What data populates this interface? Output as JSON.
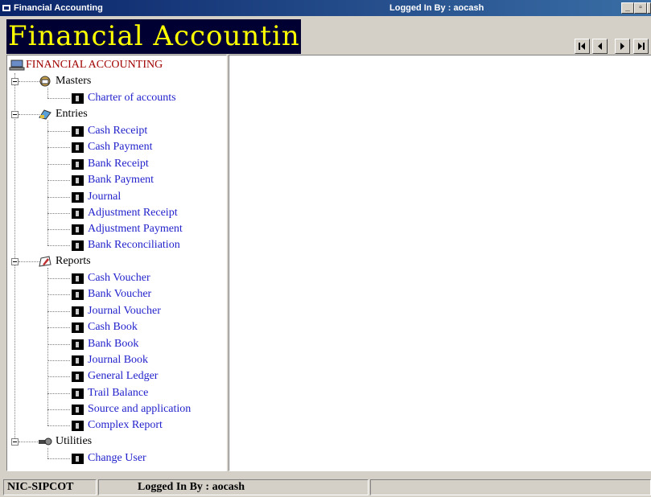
{
  "window": {
    "title": "Financial Accounting",
    "logged_in": "Logged In By : aocash",
    "minimize": "_",
    "maximize": "▫",
    "close": "x"
  },
  "banner": {
    "title": "Financial Accounting System"
  },
  "tree": {
    "root": "FINANCIAL ACCOUNTING",
    "groups": [
      {
        "label": "Masters",
        "icon": "masters-icon",
        "items": [
          "Charter of accounts"
        ]
      },
      {
        "label": "Entries",
        "icon": "entries-icon",
        "items": [
          "Cash Receipt",
          "Cash Payment",
          "Bank Receipt",
          "Bank Payment",
          "Journal",
          "Adjustment Receipt",
          "Adjustment Payment",
          "Bank Reconciliation"
        ]
      },
      {
        "label": "Reports",
        "icon": "reports-icon",
        "items": [
          "Cash Voucher",
          "Bank Voucher",
          "Journal Voucher",
          "Cash Book",
          "Bank Book",
          "Journal Book",
          "General Ledger",
          "Trail Balance",
          "Source and application",
          "Complex Report"
        ]
      },
      {
        "label": "Utilities",
        "icon": "utilities-icon",
        "items": [
          "Change User"
        ]
      }
    ]
  },
  "statusbar": {
    "org": "NIC-SIPCOT",
    "logged_in": "Logged In By : aocash",
    "extra": ""
  },
  "colors": {
    "titlebar": "#0a246a",
    "banner_bg": "#000033",
    "banner_text": "#ffff00",
    "link": "#2222cc",
    "root": "#a00000"
  }
}
